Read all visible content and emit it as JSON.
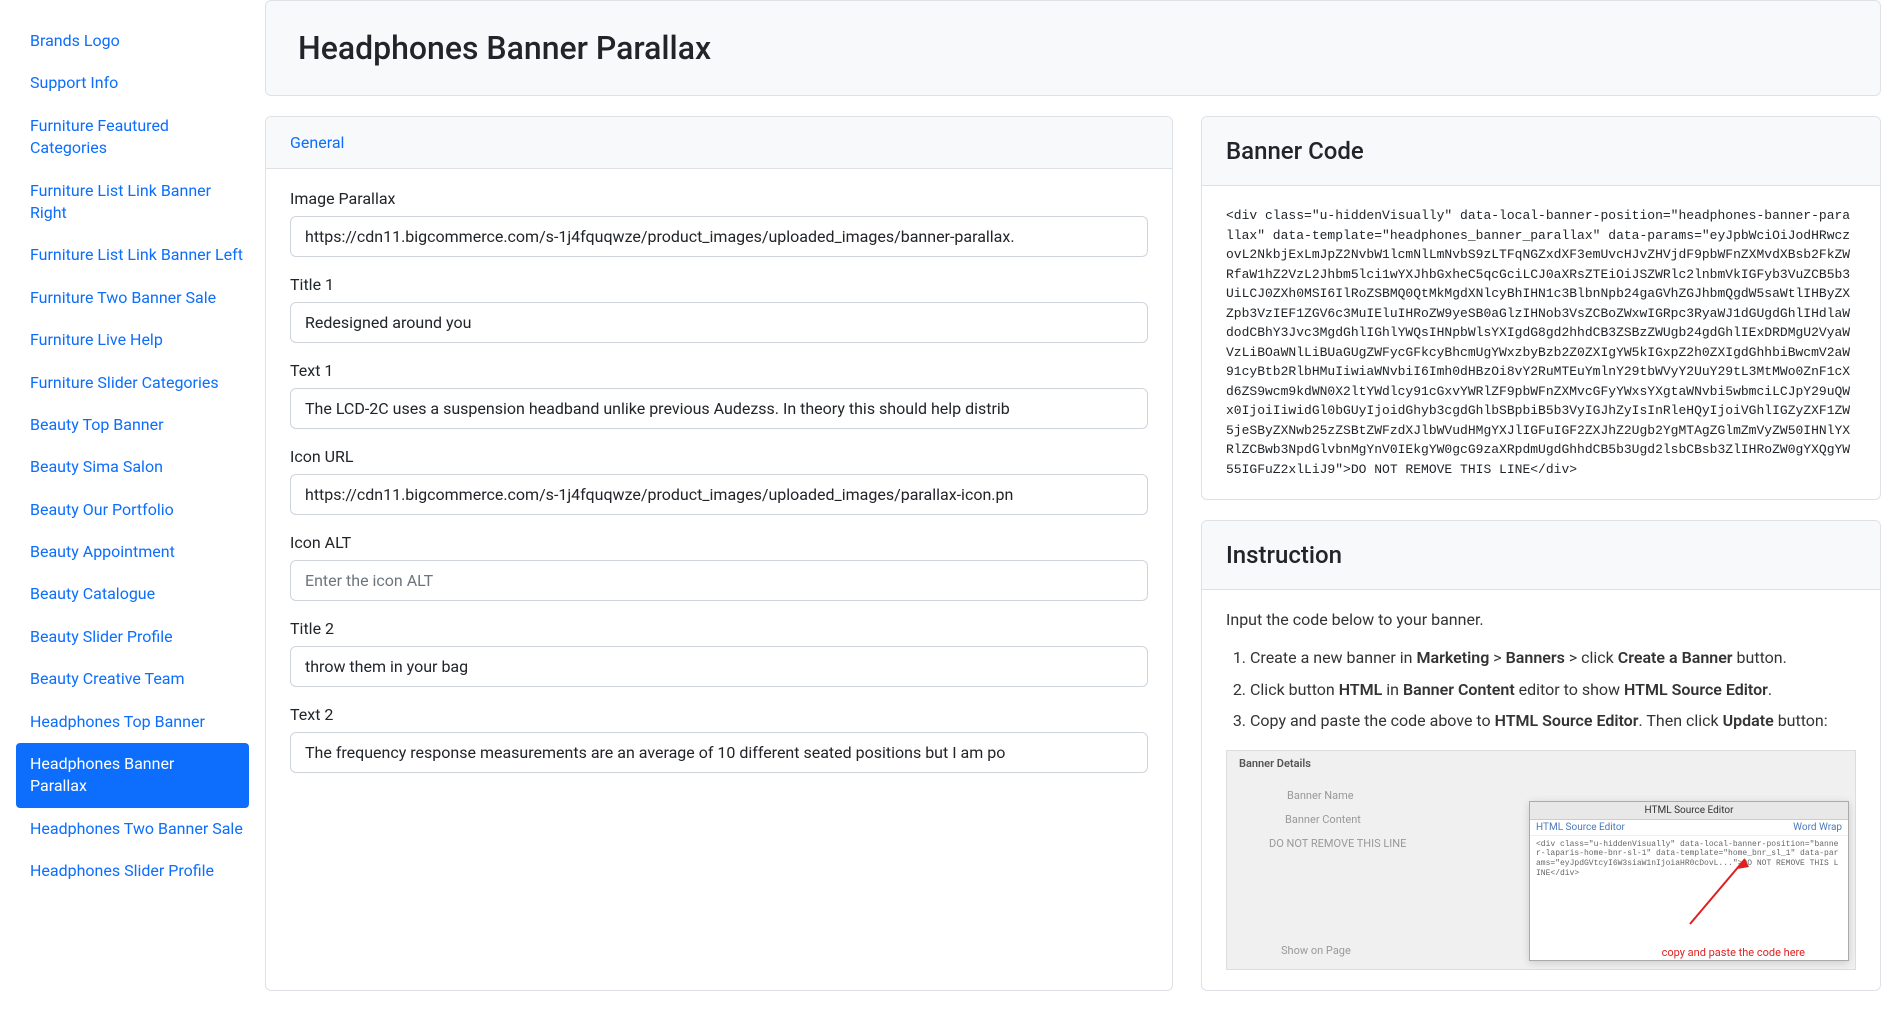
{
  "sidebar": {
    "items": [
      {
        "label": "Brands Logo",
        "active": false
      },
      {
        "label": "Support Info",
        "active": false
      },
      {
        "label": "Furniture Feautured Categories",
        "active": false
      },
      {
        "label": "Furniture List Link Banner Right",
        "active": false
      },
      {
        "label": "Furniture List Link Banner Left",
        "active": false
      },
      {
        "label": "Furniture Two Banner Sale",
        "active": false
      },
      {
        "label": "Furniture Live Help",
        "active": false
      },
      {
        "label": "Furniture Slider Categories",
        "active": false
      },
      {
        "label": "Beauty Top Banner",
        "active": false
      },
      {
        "label": "Beauty Sima Salon",
        "active": false
      },
      {
        "label": "Beauty Our Portfolio",
        "active": false
      },
      {
        "label": "Beauty Appointment",
        "active": false
      },
      {
        "label": "Beauty Catalogue",
        "active": false
      },
      {
        "label": "Beauty Slider Profile",
        "active": false
      },
      {
        "label": "Beauty Creative Team",
        "active": false
      },
      {
        "label": "Headphones Top Banner",
        "active": false
      },
      {
        "label": "Headphones Banner Parallax",
        "active": true
      },
      {
        "label": "Headphones Two Banner Sale",
        "active": false
      },
      {
        "label": "Headphones Slider Profile",
        "active": false
      }
    ]
  },
  "pageTitle": "Headphones Banner Parallax",
  "tab": {
    "general": "General"
  },
  "form": {
    "imageParallax": {
      "label": "Image Parallax",
      "value": "https://cdn11.bigcommerce.com/s-1j4fquqwze/product_images/uploaded_images/banner-parallax."
    },
    "title1": {
      "label": "Title 1",
      "value": "Redesigned around you"
    },
    "text1": {
      "label": "Text 1",
      "value": "The LCD-2C uses a suspension headband unlike previous Audezss. In theory this should help distrib"
    },
    "iconUrl": {
      "label": "Icon URL",
      "value": "https://cdn11.bigcommerce.com/s-1j4fquqwze/product_images/uploaded_images/parallax-icon.pn"
    },
    "iconAlt": {
      "label": "Icon ALT",
      "value": "",
      "placeholder": "Enter the icon ALT"
    },
    "title2": {
      "label": "Title 2",
      "value": "throw them in your bag"
    },
    "text2": {
      "label": "Text 2",
      "value": "The frequency response measurements are an average of 10 different seated positions but I am po"
    }
  },
  "bannerCode": {
    "title": "Banner Code",
    "code": "<div class=\"u-hiddenVisually\" data-local-banner-position=\"headphones-banner-parallax\" data-template=\"headphones_banner_parallax\" data-params=\"eyJpbWciOiJodHRwczovL2NkbjExLmJpZ2NvbW1lcmNlLmNvbS9zLTFqNGZxdXF3emUvcHJvZHVjdF9pbWFnZXMvdXBsb2FkZWRfaW1hZ2VzL2Jhbm5lci1wYXJhbGxheC5qcGciLCJ0aXRsZTEiOiJSZWRlc2lnbmVkIGFyb3VuZCB5b3UiLCJ0ZXh0MSI6IlRoZSBMQ0QtMkMgdXNlcyBhIHN1c3BlbnNpb24gaGVhZGJhbmQgdW5saWtlIHByZXZpb3VzIEF1ZGV6c3MuIEluIHRoZW9yeSB0aGlzIHNob3VsZCBoZWxwIGRpc3RyaWJ1dGUgdGhlIHdlaWdodCBhY3Jvc3MgdGhlIGhlYWQsIHNpbWlsYXIgdG8gd2hhdCB3ZSBzZWUgb24gdGhlIExDRDMgU2VyaWVzLiBOaWNlLiBUaGUgZWFycGFkcyBhcmUgYWxzbyBzb2Z0ZXIgYW5kIGxpZ2h0ZXIgdGhhbiBwcmV2aW91cyBtb2RlbHMuIiwiaWNvbiI6Imh0dHBzOi8vY2RuMTEuYmlnY29tbWVyY2UuY29tL3MtMWo0ZnF1cXd6ZS9wcm9kdWN0X2ltYWdlcy91cGxvYWRlZF9pbWFnZXMvcGFyYWxsYXgtaWNvbi5wbmciLCJpY29uQWx0IjoiIiwidGl0bGUyIjoidGhyb3cgdGhlbSBpbiB5b3VyIGJhZyIsInRleHQyIjoiVGhlIGZyZXF1ZW5jeSByZXNwb25zZSBtZWFzdXJlbWVudHMgYXJlIGFuIGF2ZXJhZ2Ugb2YgMTAgZGlmZmVyZW50IHNlYXRlZCBwb3NpdGlvbnMgYnV0IEkgYW0gcG9zaXRpdmUgdGhhdCB5b3Ugd2lsbCBsb3ZlIHRoZW0gYXQgYW55IGFuZ2xlLiJ9\">DO NOT REMOVE THIS LINE</div>"
  },
  "instruction": {
    "title": "Instruction",
    "intro": "Input the code below to your banner.",
    "steps": [
      {
        "pre": "Create a new banner in ",
        "b1": "Marketing",
        "mid1": " > ",
        "b2": "Banners",
        "mid2": " > click ",
        "b3": "Create a Banner",
        "post": " button."
      },
      {
        "pre": "Click button ",
        "b1": "HTML",
        "mid1": " in ",
        "b2": "Banner Content",
        "mid2": " editor to show ",
        "b3": "HTML Source Editor",
        "post": "."
      },
      {
        "pre": "Copy and paste the code above to ",
        "b1": "HTML Source Editor",
        "mid1": ". Then click ",
        "b2": "Update",
        "mid2": "",
        "b3": "",
        "post": " button:"
      }
    ],
    "screenshot": {
      "bannerDetails": "Banner Details",
      "bannerName": "Banner Name",
      "bannerContent": "Banner Content",
      "doNotRemove": "DO NOT REMOVE THIS LINE",
      "showOnPage": "Show on Page",
      "editorTitle": "HTML Source Editor",
      "editorSub": "HTML Source Editor",
      "wordWrap": "Word Wrap",
      "snippet": "<div class=\"u-hiddenVisually\" data-local-banner-position=\"banner-laparis-home-bnr-sl-1\" data-template=\"home_bnr_sl_1\" data-params=\"eyJpdGVtcyI6W3siaW1nIjoiaHR0cDovL...\">DO NOT REMOVE THIS LINE</div>",
      "arrowLabel": "copy and paste the code here"
    }
  }
}
